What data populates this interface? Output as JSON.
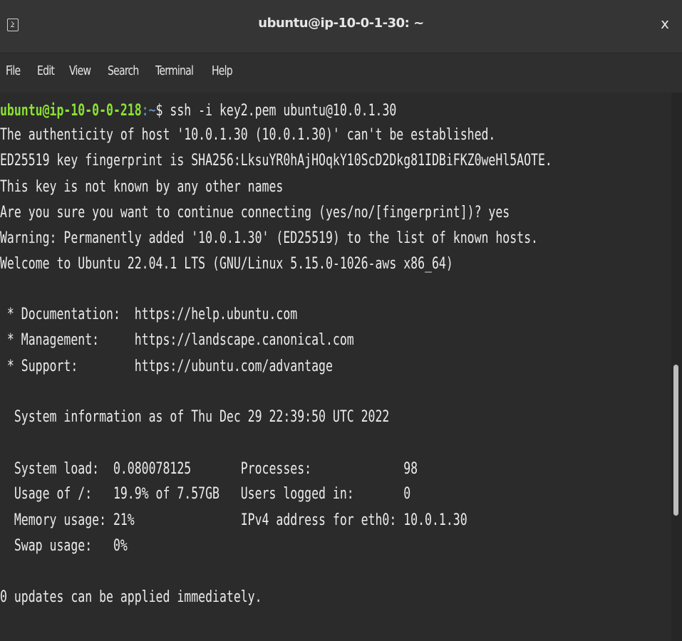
{
  "window": {
    "title": "ubuntu@ip-10-0-1-30: ~",
    "close_glyph": "x",
    "icon": "terminal-icon"
  },
  "menu": {
    "items": [
      "File",
      "Edit",
      "View",
      "Search",
      "Terminal",
      "Help"
    ]
  },
  "terminal": {
    "prompt_user_host": "ubuntu@ip-10-0-0-218",
    "prompt_path": ":~",
    "prompt_symbol": "$ ",
    "command": "ssh -i key2.pem ubuntu@10.0.1.30",
    "output": [
      "The authenticity of host '10.0.1.30 (10.0.1.30)' can't be established.",
      "ED25519 key fingerprint is SHA256:LksuYR0hAjHOqkY10ScD2Dkg81IDBiFKZ0weHl5AOTE.",
      "This key is not known by any other names",
      "Are you sure you want to continue connecting (yes/no/[fingerprint])? yes",
      "Warning: Permanently added '10.0.1.30' (ED25519) to the list of known hosts.",
      "Welcome to Ubuntu 22.04.1 LTS (GNU/Linux 5.15.0-1026-aws x86_64)",
      "",
      " * Documentation:  https://help.ubuntu.com",
      " * Management:     https://landscape.canonical.com",
      " * Support:        https://ubuntu.com/advantage",
      "",
      "  System information as of Thu Dec 29 22:39:50 UTC 2022",
      "",
      "  System load:  0.080078125       Processes:             98",
      "  Usage of /:   19.9% of 7.57GB   Users logged in:       0",
      "  Memory usage: 21%               IPv4 address for eth0: 10.0.1.30",
      "  Swap usage:   0%",
      "",
      "0 updates can be applied immediately."
    ]
  },
  "colors": {
    "prompt_user": "#8ae234",
    "prompt_path": "#729fcf",
    "text": "#ececec",
    "background": "#2b2b2b"
  }
}
